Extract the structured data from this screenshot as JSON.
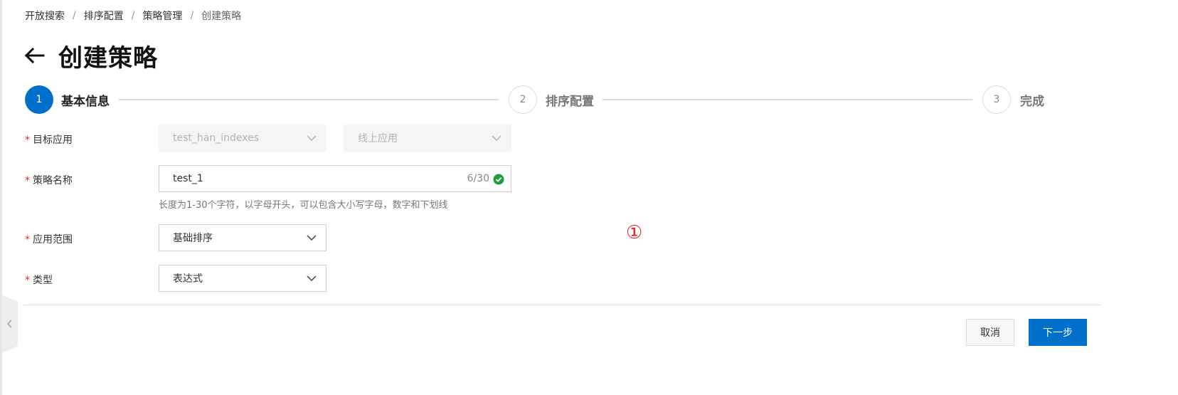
{
  "breadcrumb": {
    "items": [
      "开放搜索",
      "排序配置",
      "策略管理"
    ],
    "current": "创建策略",
    "separator": "/"
  },
  "header": {
    "title": "创建策略"
  },
  "steps": [
    {
      "number": "1",
      "label": "基本信息",
      "state": "active"
    },
    {
      "number": "2",
      "label": "排序配置",
      "state": "inactive"
    },
    {
      "number": "3",
      "label": "完成",
      "state": "inactive"
    }
  ],
  "form": {
    "target_app": {
      "label": "目标应用",
      "required_mark": "*",
      "app_select": "test_han_indexes",
      "env_select": "线上应用",
      "disabled": true
    },
    "policy_name": {
      "label": "策略名称",
      "required_mark": "*",
      "value": "test_1",
      "counter": "6/30",
      "status_icon": "check-circle-icon",
      "hint": "长度为1-30个字符，以字母开头，可以包含大小写字母，数字和下划线"
    },
    "scope": {
      "label": "应用范围",
      "required_mark": "*",
      "value": "基础排序"
    },
    "type": {
      "label": "类型",
      "required_mark": "*",
      "value": "表达式"
    }
  },
  "annotation": {
    "marker": "①"
  },
  "footer": {
    "cancel_label": "取消",
    "next_label": "下一步"
  },
  "colors": {
    "primary": "#0070cc",
    "required": "#e0282e",
    "success": "#1e9e3e",
    "annotation": "#e02020"
  }
}
